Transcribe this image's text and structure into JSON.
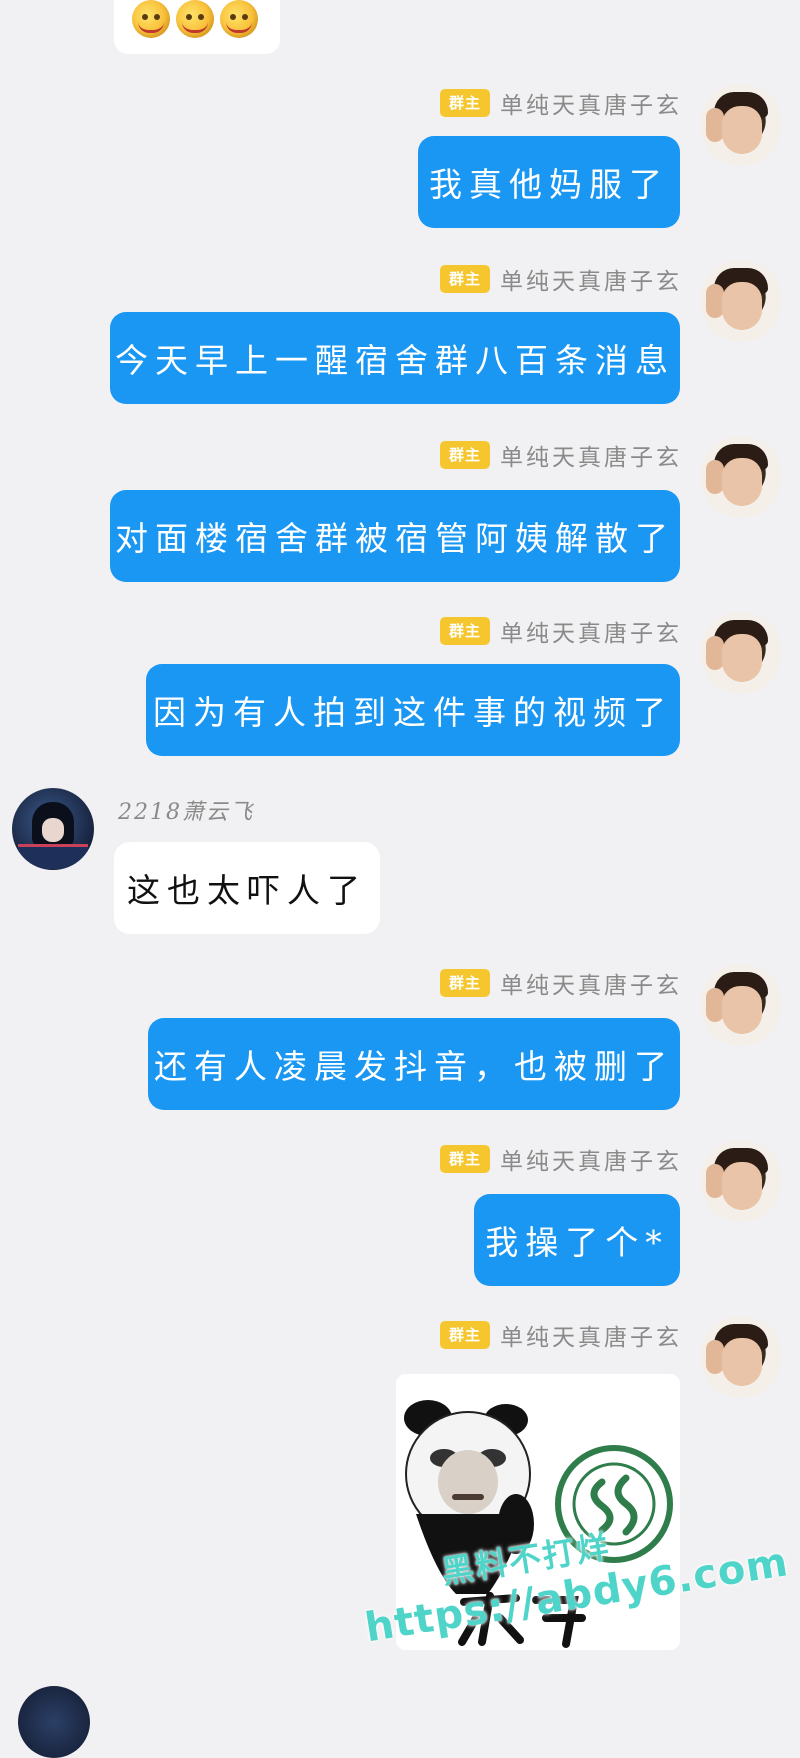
{
  "colors": {
    "background": "#f1f1f3",
    "bubble_blue": "#1a97f3",
    "bubble_white": "#ffffff",
    "badge": "#f5c62e",
    "watermark": "#4fd4c9"
  },
  "top_partial": {
    "emoji_icons": [
      "smiley-emoji",
      "smiley-emoji",
      "smiley-emoji"
    ]
  },
  "messages": [
    {
      "role": "群主",
      "sender": "单纯天真唐子玄",
      "text": "我真他妈服了"
    },
    {
      "role": "群主",
      "sender": "单纯天真唐子玄",
      "text": "今天早上一醒宿舍群八百条消息"
    },
    {
      "role": "群主",
      "sender": "单纯天真唐子玄",
      "text": "对面楼宿舍群被宿管阿姨解散了"
    },
    {
      "role": "群主",
      "sender": "单纯天真唐子玄",
      "text": "因为有人拍到这件事的视频了"
    },
    {
      "sender": "2218萧云飞",
      "text": "这也太吓人了"
    },
    {
      "role": "群主",
      "sender": "单纯天真唐子玄",
      "text": "还有人凌晨发抖音，也被删了"
    },
    {
      "role": "群主",
      "sender": "单纯天真唐子玄",
      "text": "我操了个*"
    },
    {
      "role": "群主",
      "sender": "单纯天真唐子玄",
      "image": "panda-meme-with-university-seal"
    }
  ],
  "watermark": {
    "line1": "黑料不打烊",
    "line2": "https://abdy6.com"
  }
}
